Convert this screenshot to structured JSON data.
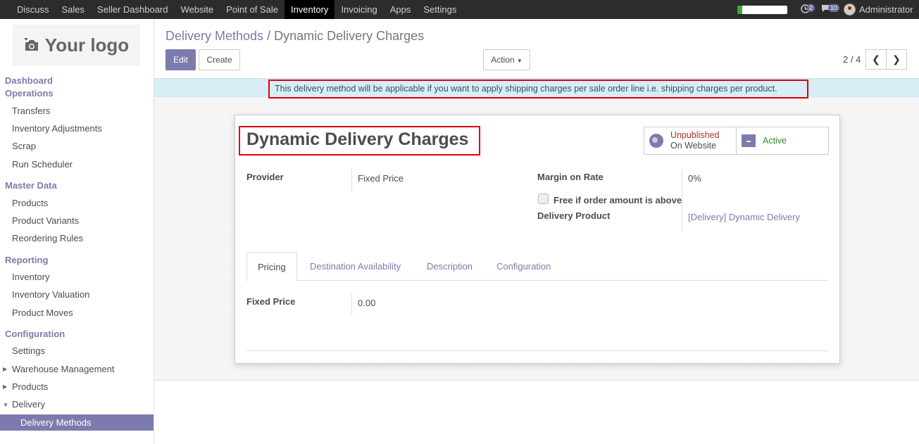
{
  "topbar": {
    "menu": [
      "Discuss",
      "Sales",
      "Seller Dashboard",
      "Website",
      "Point of Sale",
      "Inventory",
      "Invoicing",
      "Apps",
      "Settings"
    ],
    "active": "Inventory",
    "activity_count": "2",
    "message_count": "10",
    "user": "Administrator",
    "progress": 0.1
  },
  "sidebar": {
    "logo_text": "Your logo",
    "dashboard": "Dashboard",
    "operations": "Operations",
    "operations_items": [
      "Transfers",
      "Inventory Adjustments",
      "Scrap",
      "Run Scheduler"
    ],
    "master_data": "Master Data",
    "master_items": [
      "Products",
      "Product Variants",
      "Reordering Rules"
    ],
    "reporting": "Reporting",
    "reporting_items": [
      "Inventory",
      "Inventory Valuation",
      "Product Moves"
    ],
    "configuration": "Configuration",
    "config_items": [
      "Settings",
      "Warehouse Management",
      "Products",
      "Delivery"
    ],
    "active_item": "Delivery Methods"
  },
  "control": {
    "breadcrumb_parent": "Delivery Methods",
    "breadcrumb_sep": "/",
    "breadcrumb_current": "Dynamic Delivery Charges",
    "edit": "Edit",
    "create": "Create",
    "action": "Action",
    "pager": "2 / 4"
  },
  "banner": "This delivery method will be applicable if you want to apply shipping charges per sale order line i.e. shipping charges per product.",
  "form": {
    "title": "Dynamic Delivery Charges",
    "unpublished": "Unpublished",
    "on_website": "On Website",
    "active": "Active",
    "provider_label": "Provider",
    "provider_value": "Fixed Price",
    "margin_label": "Margin on Rate",
    "margin_value": "0%",
    "free_label": "Free if order amount is above",
    "delivery_product_label": "Delivery Product",
    "delivery_product_value": "[Delivery] Dynamic Delivery",
    "tabs": [
      "Pricing",
      "Destination Availability",
      "Description",
      "Configuration"
    ],
    "fixed_price_label": "Fixed Price",
    "fixed_price_value": "0.00"
  },
  "colors": {
    "brand": "#7c7bad",
    "banner": "#d9edf7",
    "highlight": "#e0000a"
  }
}
